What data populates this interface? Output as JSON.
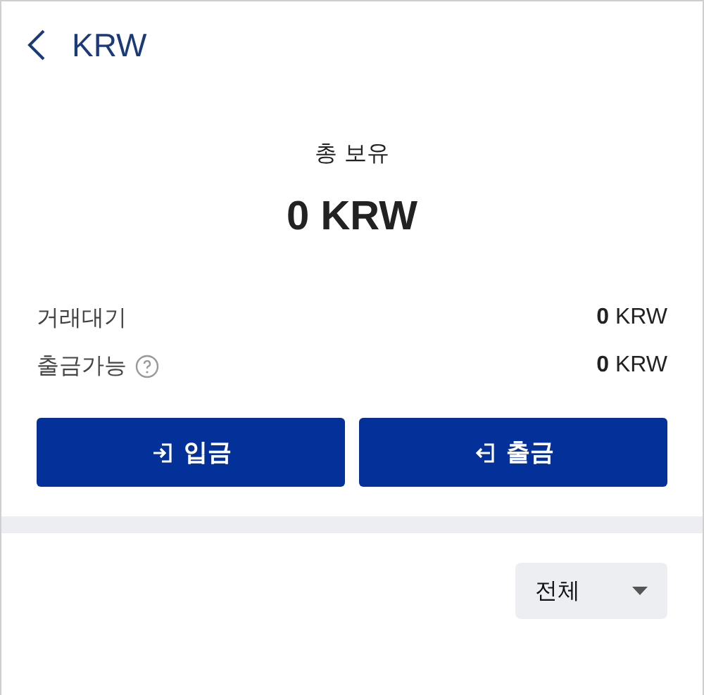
{
  "header": {
    "title": "KRW"
  },
  "total": {
    "label": "총 보유",
    "amount": "0 KRW"
  },
  "rows": [
    {
      "label": "거래대기",
      "help": false,
      "value": "**0** KRW"
    },
    {
      "label": "출금가능",
      "help": true,
      "value": "**0** KRW"
    }
  ],
  "buttons": [
    {
      "label": "입금",
      "kind": "deposit"
    },
    {
      "label": "출금",
      "kind": "withdraw"
    }
  ],
  "filter": {
    "value": "전체"
  }
}
